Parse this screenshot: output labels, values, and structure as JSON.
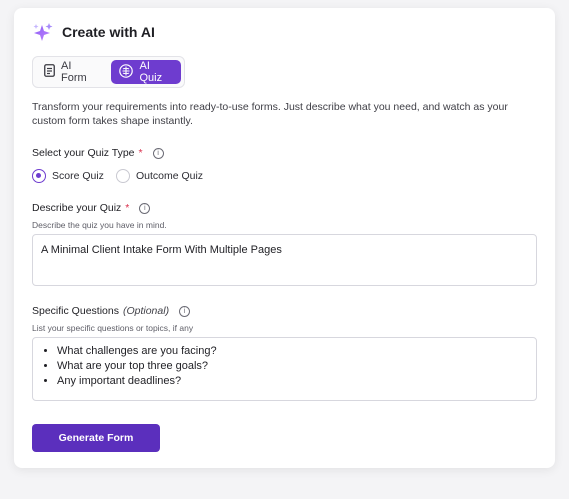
{
  "header": {
    "title": "Create with AI",
    "icon": "sparkle-icon"
  },
  "mode_toggle": {
    "options": [
      {
        "label": "AI Form",
        "icon": "document-icon",
        "active": false
      },
      {
        "label": "AI Quiz",
        "icon": "brain-icon",
        "active": true
      }
    ]
  },
  "description": "Transform your requirements into ready-to-use forms. Just describe what you need, and watch as your custom form takes shape instantly.",
  "quiz_type": {
    "label": "Select your Quiz Type",
    "required_mark": "*",
    "options": [
      {
        "label": "Score Quiz",
        "selected": true
      },
      {
        "label": "Outcome Quiz",
        "selected": false
      }
    ]
  },
  "describe_quiz": {
    "label": "Describe your Quiz",
    "required_mark": "*",
    "helper": "Describe the quiz you have in mind.",
    "value": "A Minimal Client Intake Form With Multiple Pages"
  },
  "specific_questions": {
    "label": "Specific Questions",
    "optional": "(Optional)",
    "helper": "List your specific questions or topics, if any",
    "items": [
      "What challenges are you facing?",
      "What are your top three goals?",
      "Any important deadlines?"
    ]
  },
  "actions": {
    "generate_label": "Generate Form"
  },
  "colors": {
    "accent": "#6e3ccf",
    "button": "#5b2fbd",
    "required": "#d92d4a"
  }
}
